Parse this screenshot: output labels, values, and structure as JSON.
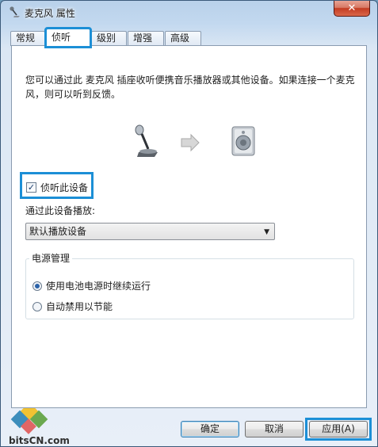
{
  "window": {
    "title": "麦克风 属性",
    "close_glyph": "✕"
  },
  "tabs": [
    {
      "label": "常规",
      "active": false
    },
    {
      "label": "侦听",
      "active": true
    },
    {
      "label": "级别",
      "active": false
    },
    {
      "label": "增强",
      "active": false
    },
    {
      "label": "高级",
      "active": false
    }
  ],
  "listen": {
    "description": "您可以通过此 麦克风 插座收听便携音乐播放器或其他设备。如果连接一个麦克风，则可以听到反馈。",
    "listen_checkbox_label": "侦听此设备",
    "listen_checked": true,
    "playback_label": "通过此设备播放:",
    "playback_device": "默认播放设备",
    "power_group_title": "电源管理",
    "power_options": [
      {
        "label": "使用电池电源时继续运行",
        "selected": true
      },
      {
        "label": "自动禁用以节能",
        "selected": false
      }
    ]
  },
  "footer": {
    "ok_label": "确定",
    "cancel_label": "取消",
    "apply_label": "应用(A)"
  },
  "watermark": {
    "text": "bitsCN.com"
  },
  "colors": {
    "highlight": "#1c8fd6",
    "close_button": "#c43c23"
  }
}
